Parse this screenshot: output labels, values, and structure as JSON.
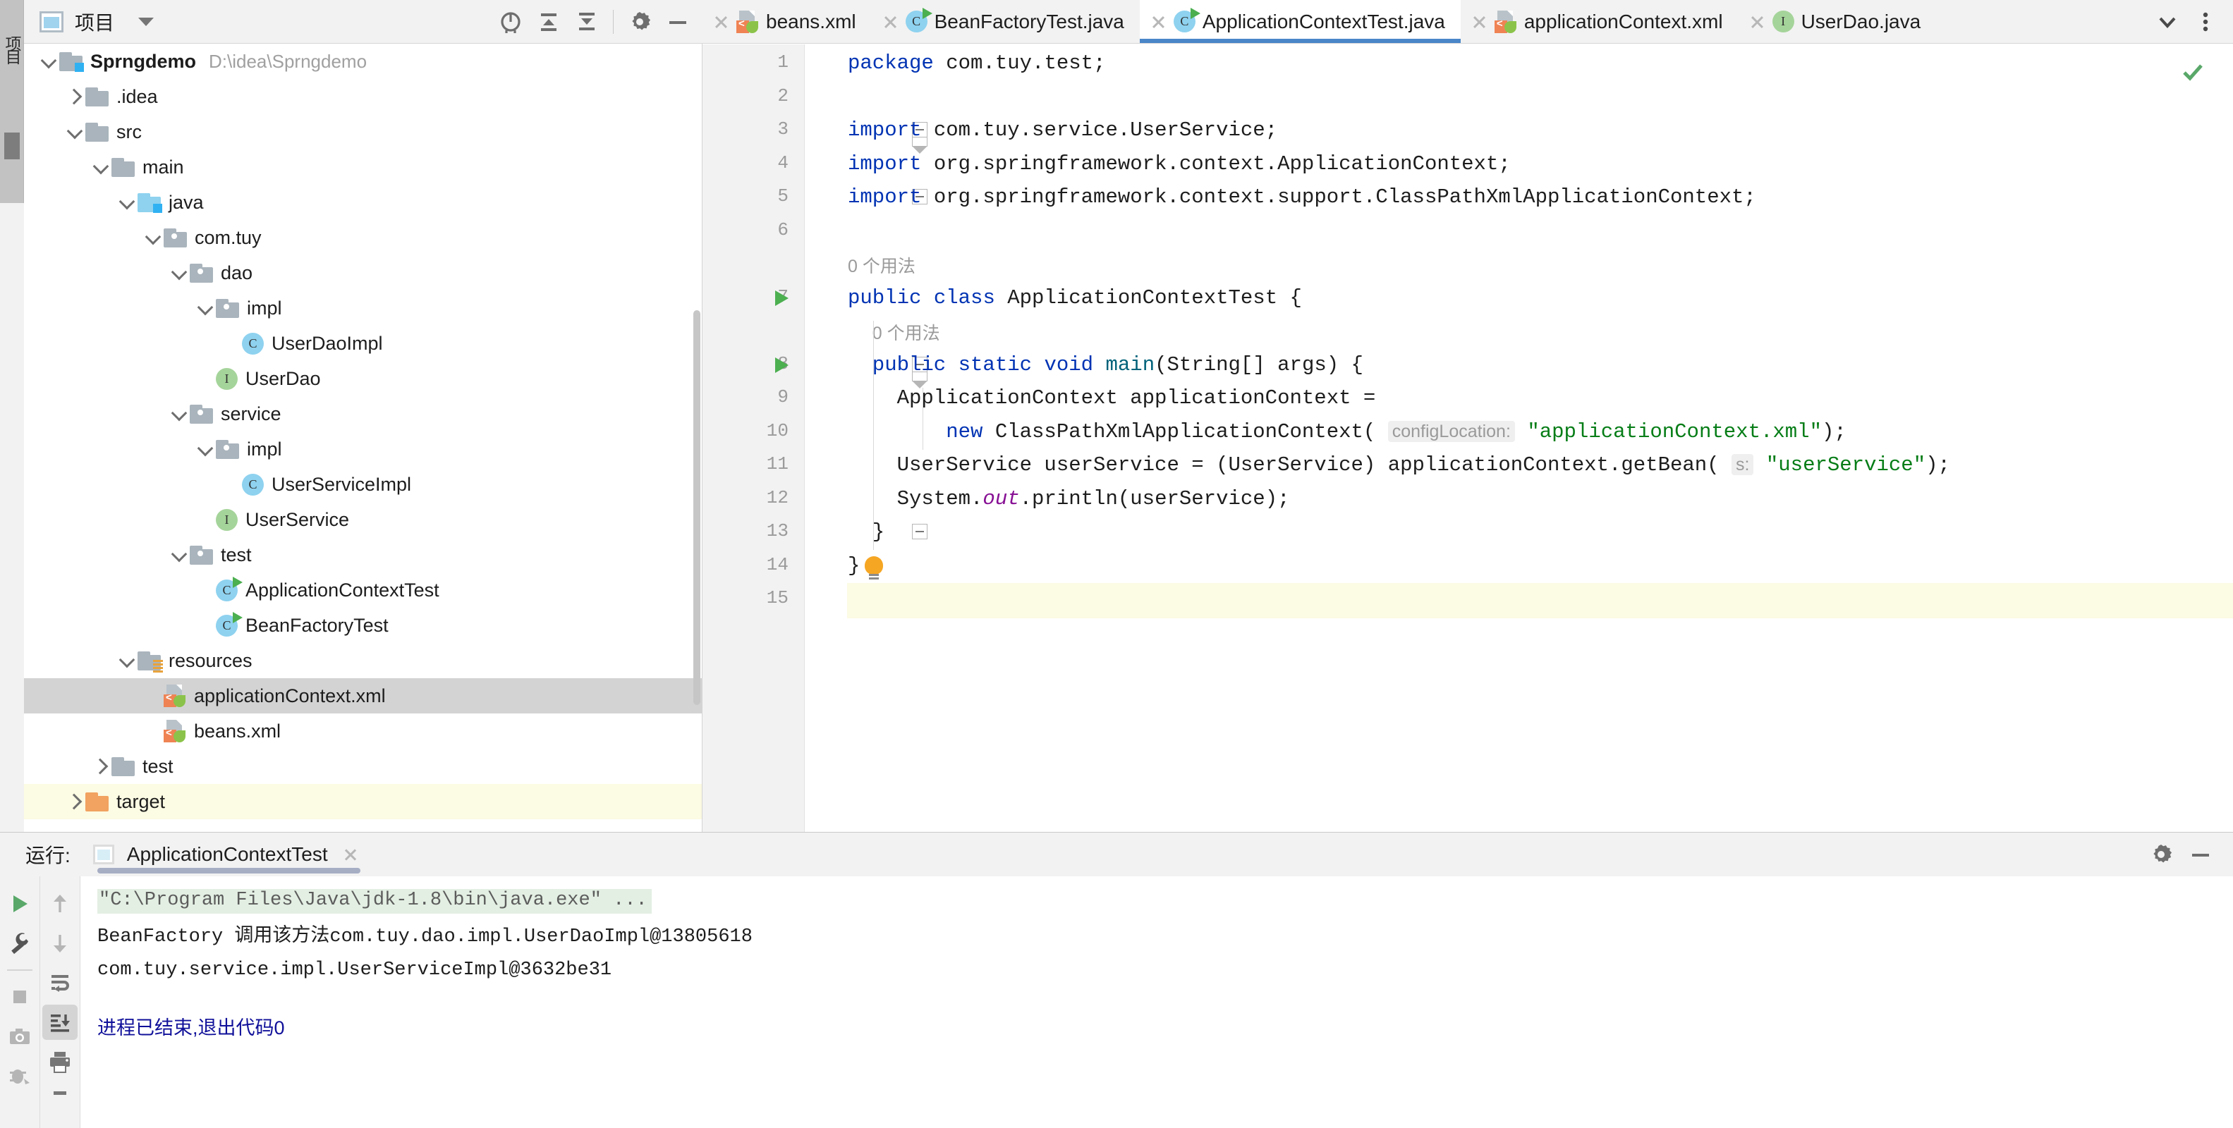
{
  "left_strip": {
    "vertical_label": "项目"
  },
  "project_panel": {
    "title": "项目",
    "icons": [
      "locate-icon",
      "collapse-up-icon",
      "expand-down-icon",
      "settings-gear-icon",
      "minimize-icon"
    ],
    "tree": [
      {
        "label": "Sprngdemo",
        "path": "D:\\idea\\Sprngdemo",
        "indent": 0,
        "twisty": "open",
        "icon": "folder-module",
        "bold": true,
        "state": ""
      },
      {
        "label": ".idea",
        "path": "",
        "indent": 1,
        "twisty": "closed",
        "icon": "folder",
        "bold": false,
        "state": ""
      },
      {
        "label": "src",
        "path": "",
        "indent": 1,
        "twisty": "open",
        "icon": "folder",
        "bold": false,
        "state": ""
      },
      {
        "label": "main",
        "path": "",
        "indent": 2,
        "twisty": "open",
        "icon": "folder",
        "bold": false,
        "state": ""
      },
      {
        "label": "java",
        "path": "",
        "indent": 3,
        "twisty": "open",
        "icon": "folder-source",
        "bold": false,
        "state": ""
      },
      {
        "label": "com.tuy",
        "path": "",
        "indent": 4,
        "twisty": "open",
        "icon": "folder-package",
        "bold": false,
        "state": ""
      },
      {
        "label": "dao",
        "path": "",
        "indent": 5,
        "twisty": "open",
        "icon": "folder-package",
        "bold": false,
        "state": ""
      },
      {
        "label": "impl",
        "path": "",
        "indent": 6,
        "twisty": "open",
        "icon": "folder-package",
        "bold": false,
        "state": ""
      },
      {
        "label": "UserDaoImpl",
        "path": "",
        "indent": 7,
        "twisty": "none",
        "icon": "class",
        "bold": false,
        "state": ""
      },
      {
        "label": "UserDao",
        "path": "",
        "indent": 6,
        "twisty": "none",
        "icon": "interface",
        "bold": false,
        "state": ""
      },
      {
        "label": "service",
        "path": "",
        "indent": 5,
        "twisty": "open",
        "icon": "folder-package",
        "bold": false,
        "state": ""
      },
      {
        "label": "impl",
        "path": "",
        "indent": 6,
        "twisty": "open",
        "icon": "folder-package",
        "bold": false,
        "state": ""
      },
      {
        "label": "UserServiceImpl",
        "path": "",
        "indent": 7,
        "twisty": "none",
        "icon": "class",
        "bold": false,
        "state": ""
      },
      {
        "label": "UserService",
        "path": "",
        "indent": 6,
        "twisty": "none",
        "icon": "interface",
        "bold": false,
        "state": ""
      },
      {
        "label": "test",
        "path": "",
        "indent": 5,
        "twisty": "open",
        "icon": "folder-package",
        "bold": false,
        "state": ""
      },
      {
        "label": "ApplicationContextTest",
        "path": "",
        "indent": 6,
        "twisty": "none",
        "icon": "class-runnable",
        "bold": false,
        "state": ""
      },
      {
        "label": "BeanFactoryTest",
        "path": "",
        "indent": 6,
        "twisty": "none",
        "icon": "class-runnable",
        "bold": false,
        "state": ""
      },
      {
        "label": "resources",
        "path": "",
        "indent": 3,
        "twisty": "open",
        "icon": "folder-resources",
        "bold": false,
        "state": ""
      },
      {
        "label": "applicationContext.xml",
        "path": "",
        "indent": 4,
        "twisty": "none",
        "icon": "spring-xml",
        "bold": false,
        "state": "selected"
      },
      {
        "label": "beans.xml",
        "path": "",
        "indent": 4,
        "twisty": "none",
        "icon": "spring-xml",
        "bold": false,
        "state": ""
      },
      {
        "label": "test",
        "path": "",
        "indent": 2,
        "twisty": "closed",
        "icon": "folder",
        "bold": false,
        "state": ""
      },
      {
        "label": "target",
        "path": "",
        "indent": 1,
        "twisty": "closed",
        "icon": "folder-target",
        "bold": false,
        "state": "highlighted"
      }
    ]
  },
  "editor": {
    "tabs": [
      {
        "label": "beans.xml",
        "icon": "spring-xml",
        "active": false
      },
      {
        "label": "BeanFactoryTest.java",
        "icon": "class-runnable",
        "active": false
      },
      {
        "label": "ApplicationContextTest.java",
        "icon": "class-runnable",
        "active": true
      },
      {
        "label": "applicationContext.xml",
        "icon": "spring-xml",
        "active": false
      },
      {
        "label": "UserDao.java",
        "icon": "interface",
        "active": false
      }
    ],
    "tab_end_buttons": [
      "chevron-down-icon",
      "more-vertical-icon"
    ],
    "inspection_status": "ok-check-icon",
    "line_numbers": [
      "1",
      "2",
      "3",
      "4",
      "5",
      "6",
      "7",
      "8",
      "9",
      "10",
      "11",
      "12",
      "13",
      "14",
      "15"
    ],
    "current_line": 15,
    "usage_hints": [
      {
        "text": "0 个用法",
        "line_above": 7
      },
      {
        "text": "0 个用法",
        "line_above": 8
      }
    ],
    "param_hints": {
      "config_location": "configLocation:",
      "get_bean": "s:"
    },
    "code_lines": {
      "l1_kw": "package",
      "l1_rest": " com.tuy.test;",
      "l3_kw": "import",
      "l3_rest": " com.tuy.service.UserService;",
      "l4_kw": "import",
      "l4_rest": " org.springframework.context.ApplicationContext;",
      "l5_kw": "import",
      "l5_rest": " org.springframework.context.support.ClassPathXmlApplicationContext;",
      "l7_kw1": "public",
      "l7_kw2": "class",
      "l7_name": "ApplicationContextTest {",
      "l8_kw1": "public",
      "l8_kw2": "static",
      "l8_kw3": "void",
      "l8_method": "main",
      "l8_rest": "(String[] args) {",
      "l9": "ApplicationContext applicationContext =",
      "l10_kw": "new",
      "l10_rest": "ClassPathXmlApplicationContext(",
      "l10_str": "\"applicationContext.xml\"",
      "l10_tail": ");",
      "l11_head": "UserService userService = (UserService) applicationContext.getBean(",
      "l11_str": "\"userService\"",
      "l11_tail": ");",
      "l12_a": "System.",
      "l12_static": "out",
      "l12_b": ".println(userService);",
      "l13": "}",
      "l14": "}"
    }
  },
  "run_panel": {
    "label": "运行:",
    "tab_name": "ApplicationContextTest",
    "header_buttons": [
      "settings-gear-icon",
      "minimize-icon"
    ],
    "left_tools": [
      "run-icon",
      "wrench-icon",
      "stop-icon",
      "camera-icon",
      "debug-icon"
    ],
    "right_tools": [
      "arrow-up-icon",
      "arrow-down-icon",
      "soft-wrap-icon",
      "scroll-to-end-icon",
      "print-icon",
      "pin-icon"
    ],
    "active_right_tool": "scroll-to-end-icon",
    "console": [
      {
        "text": "\"C:\\Program Files\\Java\\jdk-1.8\\bin\\java.exe\" ...",
        "style": "command"
      },
      {
        "text": "BeanFactory 调用该方法com.tuy.dao.impl.UserDaoImpl@13805618",
        "style": "normal"
      },
      {
        "text": "com.tuy.service.impl.UserServiceImpl@3632be31",
        "style": "normal"
      },
      {
        "text": "",
        "style": "normal"
      },
      {
        "text": "进程已结束,退出代码0",
        "style": "exit"
      }
    ]
  },
  "colors": {
    "accent_blue": "#4a86c8",
    "keyword": "#0033b3",
    "string": "#067d17",
    "static_field": "#871094",
    "method": "#00627a",
    "selection_gray": "#d3d3d3",
    "highlight_yellow": "#fcfbe3",
    "run_green": "#4caf50"
  }
}
